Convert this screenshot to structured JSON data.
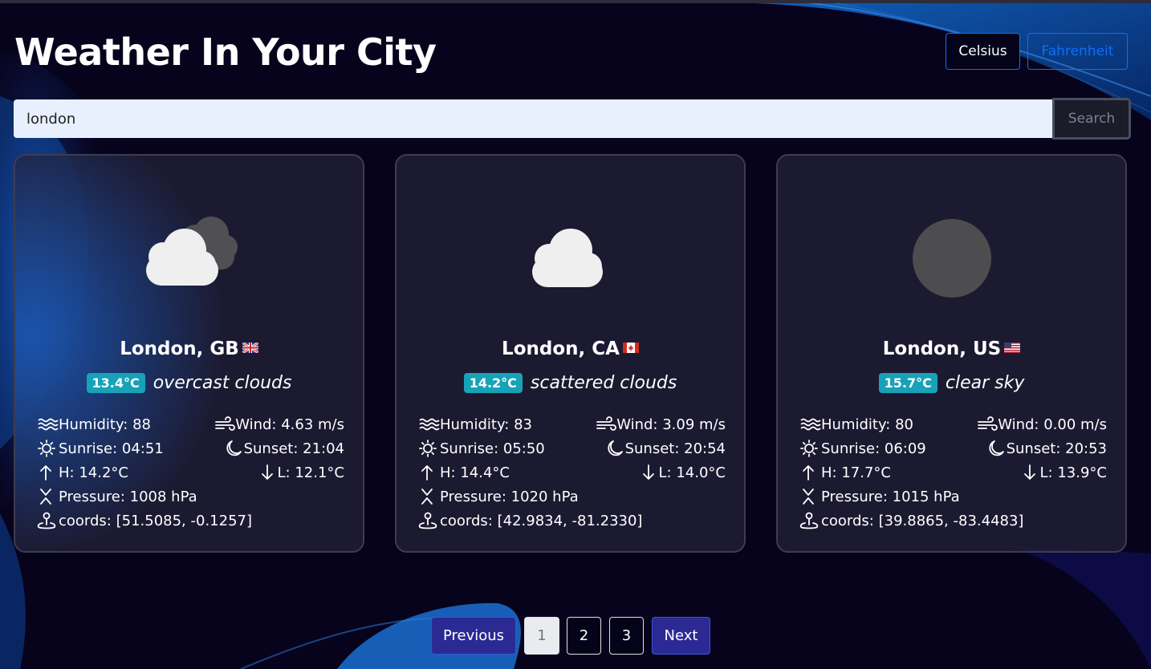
{
  "header": {
    "title": "Weather In Your City",
    "units": {
      "celsius_label": "Celsius",
      "fahrenheit_label": "Fahrenheit",
      "selected": "Celsius"
    }
  },
  "search": {
    "value": "london",
    "button_label": "Search"
  },
  "cards": [
    {
      "icon": "overcast-clouds-icon",
      "flag": "gb-flag-icon",
      "city": "London, GB",
      "temp": "13.4°C",
      "description": "overcast clouds",
      "humidity": "Humidity: 88",
      "wind": "Wind: 4.63 m/s",
      "sunrise": "Sunrise: 04:51",
      "sunset": "Sunset: 21:04",
      "high": "H: 14.2°C",
      "low": "L: 12.1°C",
      "pressure": "Pressure: 1008 hPa",
      "coords": "coords: [51.5085, -0.1257]"
    },
    {
      "icon": "scattered-clouds-icon",
      "flag": "ca-flag-icon",
      "city": "London, CA",
      "temp": "14.2°C",
      "description": "scattered clouds",
      "humidity": "Humidity: 83",
      "wind": "Wind: 3.09 m/s",
      "sunrise": "Sunrise: 05:50",
      "sunset": "Sunset: 20:54",
      "high": "H: 14.4°C",
      "low": "L: 14.0°C",
      "pressure": "Pressure: 1020 hPa",
      "coords": "coords: [42.9834, -81.2330]"
    },
    {
      "icon": "clear-sky-night-icon",
      "flag": "us-flag-icon",
      "city": "London, US",
      "temp": "15.7°C",
      "description": "clear sky",
      "humidity": "Humidity: 80",
      "wind": "Wind: 0.00 m/s",
      "sunrise": "Sunrise: 06:09",
      "sunset": "Sunset: 20:53",
      "high": "H: 17.7°C",
      "low": "L: 13.9°C",
      "pressure": "Pressure: 1015 hPa",
      "coords": "coords: [39.8865, -83.4483]"
    }
  ],
  "pagination": {
    "previous": "Previous",
    "pages": [
      "1",
      "2",
      "3"
    ],
    "current": "1",
    "next": "Next"
  },
  "colors": {
    "background": "#07031c",
    "accent": "#0d6efd",
    "badge": "#17a2b8",
    "pager_button": "#2b2994"
  }
}
